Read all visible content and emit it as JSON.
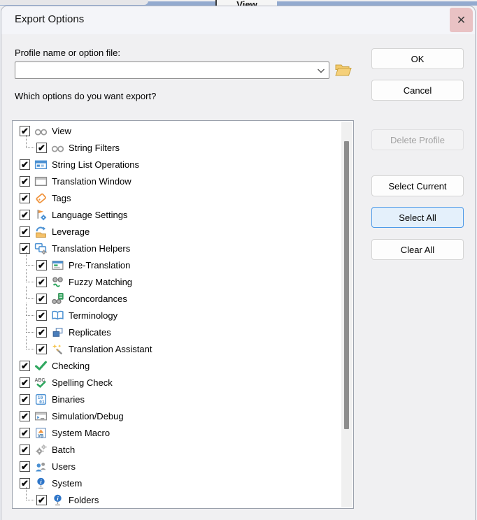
{
  "background_window": {
    "menu_label": "View"
  },
  "dialog": {
    "title": "Export Options"
  },
  "glyphs": {
    "close": "✕",
    "check": "✔"
  },
  "form": {
    "profile_label": "Profile name or option file:",
    "combo_value": "",
    "combo_placeholder": "",
    "options_label": "Which options do you want export?"
  },
  "action_buttons": [
    {
      "label": "OK",
      "state": "normal"
    },
    {
      "label": "Cancel",
      "state": "normal"
    },
    {
      "label": "Delete Profile",
      "state": "disabled"
    },
    {
      "label": "Select Current",
      "state": "normal"
    },
    {
      "label": "Select All",
      "state": "focused"
    },
    {
      "label": "Clear All",
      "state": "normal"
    }
  ],
  "tree": {
    "items": [
      {
        "label": "View",
        "icon": "glasses",
        "checked": true,
        "level": 0
      },
      {
        "label": "String Filters",
        "icon": "glasses",
        "checked": true,
        "level": 1
      },
      {
        "label": "String List Operations",
        "icon": "string-list",
        "checked": true,
        "level": 0
      },
      {
        "label": "Translation Window",
        "icon": "window",
        "checked": true,
        "level": 0
      },
      {
        "label": "Tags",
        "icon": "tag",
        "checked": true,
        "level": 0
      },
      {
        "label": "Language Settings",
        "icon": "language-settings",
        "checked": true,
        "level": 0
      },
      {
        "label": "Leverage",
        "icon": "leverage",
        "checked": true,
        "level": 0
      },
      {
        "label": "Translation Helpers",
        "icon": "helpers",
        "checked": true,
        "level": 0
      },
      {
        "label": "Pre-Translation",
        "icon": "pre-translation",
        "checked": true,
        "level": 1
      },
      {
        "label": "Fuzzy Matching",
        "icon": "fuzzy-matching",
        "checked": true,
        "level": 1
      },
      {
        "label": "Concordances",
        "icon": "concordances",
        "checked": true,
        "level": 1
      },
      {
        "label": "Terminology",
        "icon": "terminology",
        "checked": true,
        "level": 1
      },
      {
        "label": "Replicates",
        "icon": "replicates",
        "checked": true,
        "level": 1
      },
      {
        "label": "Translation Assistant",
        "icon": "assistant",
        "checked": true,
        "level": 1
      },
      {
        "label": "Checking",
        "icon": "check",
        "checked": true,
        "level": 0
      },
      {
        "label": "Spelling Check",
        "icon": "spelling",
        "checked": true,
        "level": 0
      },
      {
        "label": "Binaries",
        "icon": "binaries",
        "checked": true,
        "level": 0
      },
      {
        "label": "Simulation/Debug",
        "icon": "simulation",
        "checked": true,
        "level": 0
      },
      {
        "label": "System Macro",
        "icon": "macro",
        "checked": true,
        "level": 0
      },
      {
        "label": "Batch",
        "icon": "batch",
        "checked": true,
        "level": 0
      },
      {
        "label": "Users",
        "icon": "users",
        "checked": true,
        "level": 0
      },
      {
        "label": "System",
        "icon": "system-info",
        "checked": true,
        "level": 0
      },
      {
        "label": "Folders",
        "icon": "system-info",
        "checked": true,
        "level": 1
      }
    ]
  },
  "colors": {
    "close_hover": "#e9c2c4",
    "focus_border": "#4f9be8",
    "focus_fill": "#e4f0fb",
    "band_blue": "#93aacf",
    "green_check": "#2fa75f",
    "icon_blue": "#4a90d2",
    "icon_orange": "#f0953f"
  }
}
